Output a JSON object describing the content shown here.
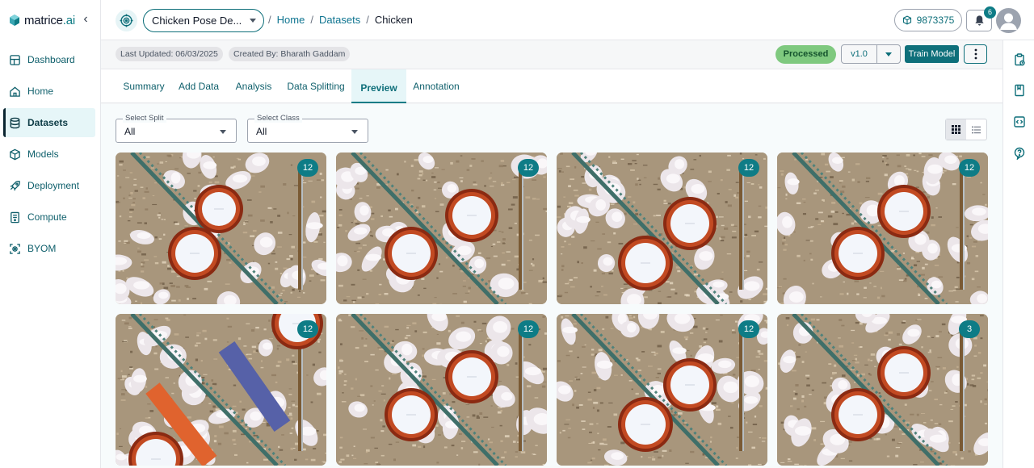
{
  "brand": {
    "name": "matrice",
    "suffix": ".ai",
    "collapse_glyph": "‹"
  },
  "sidebar": {
    "items": [
      {
        "label": "Dashboard",
        "icon": "dashboard-icon",
        "active": false
      },
      {
        "label": "Home",
        "icon": "home-icon",
        "active": false
      },
      {
        "label": "Datasets",
        "icon": "database-icon",
        "active": true
      },
      {
        "label": "Models",
        "icon": "cube-icon",
        "active": false
      },
      {
        "label": "Deployment",
        "icon": "rocket-icon",
        "active": false
      },
      {
        "label": "Compute",
        "icon": "server-icon",
        "active": false
      },
      {
        "label": "BYOM",
        "icon": "camera-icon",
        "active": false
      }
    ]
  },
  "header": {
    "project": "Chicken Pose De...",
    "breadcrumb": {
      "sep": "/",
      "home": "Home",
      "datasets": "Datasets",
      "current": "Chicken"
    },
    "credits": "9873375",
    "notifications": "6"
  },
  "meta": {
    "last_updated": "Last Updated: 06/03/2025",
    "created_by": "Created By: Bharath Gaddam",
    "status": "Processed",
    "version": "v1.0",
    "train_label": "Train Model"
  },
  "tabs": [
    "Summary",
    "Add Data",
    "Analysis",
    "Data Splitting",
    "Preview",
    "Annotation"
  ],
  "active_tab": "Preview",
  "filters": {
    "split": {
      "label": "Select Split",
      "value": "All"
    },
    "class": {
      "label": "Select Class",
      "value": "All"
    }
  },
  "view_mode": "grid",
  "colors": {
    "accent": "#0e7c86",
    "status_bg": "#7fc97f",
    "active_bg": "#e6f6f8"
  },
  "cards": [
    {
      "count": "12",
      "variant": "a"
    },
    {
      "count": "12",
      "variant": "b"
    },
    {
      "count": "12",
      "variant": "c"
    },
    {
      "count": "12",
      "variant": "d"
    },
    {
      "count": "12",
      "variant": "e"
    },
    {
      "count": "12",
      "variant": "b"
    },
    {
      "count": "12",
      "variant": "c"
    },
    {
      "count": "3",
      "variant": "d"
    }
  ]
}
